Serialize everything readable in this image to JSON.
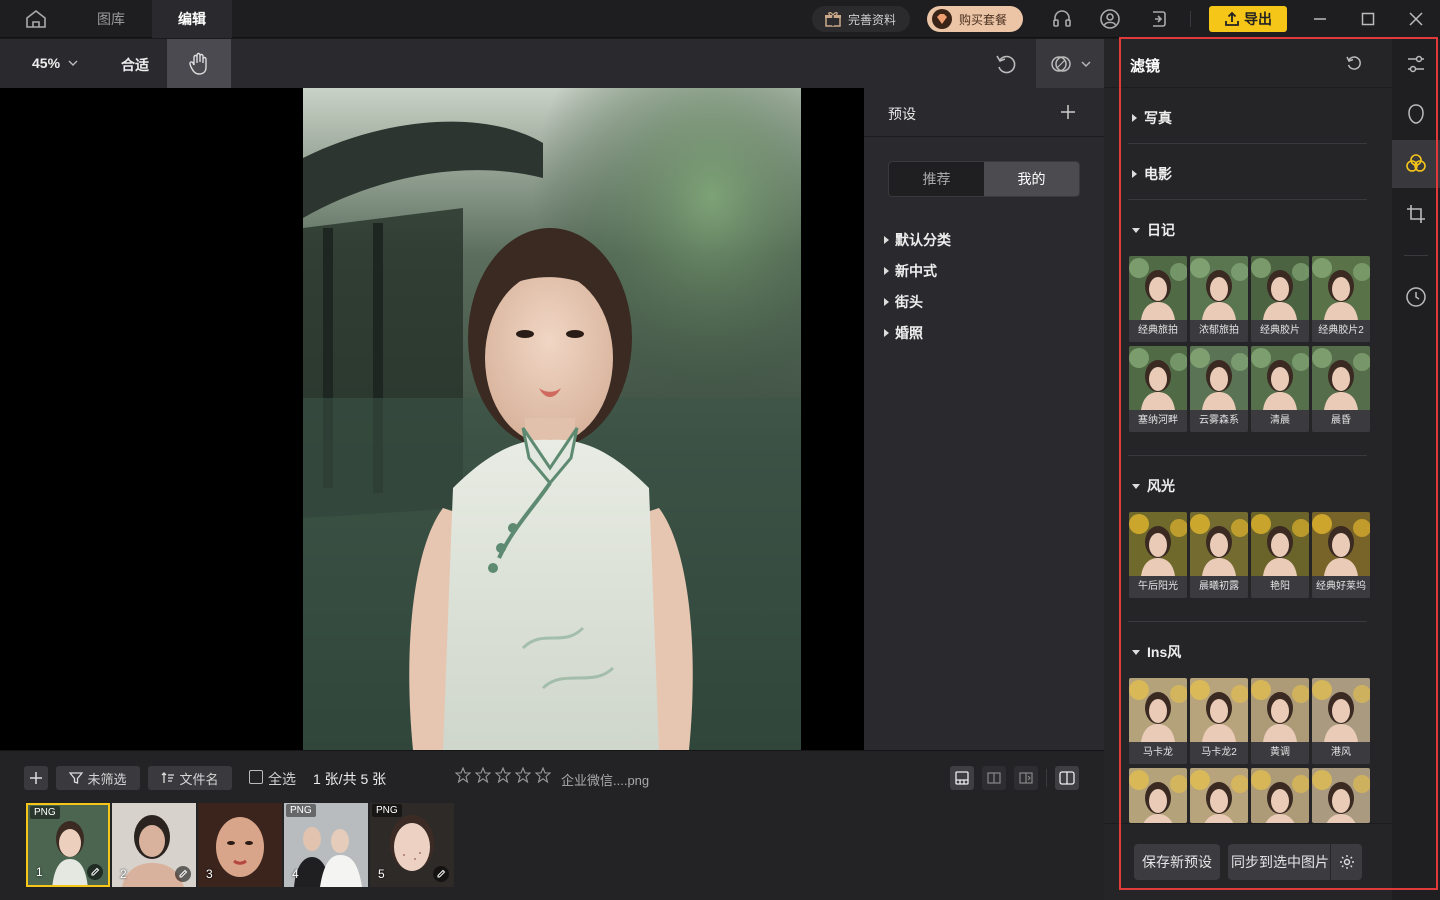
{
  "topbar": {
    "tabs": [
      {
        "label": "图库"
      },
      {
        "label": "编辑"
      }
    ],
    "profile_label": "完善资料",
    "buy_label": "购买套餐",
    "export_label": "导出"
  },
  "toolbar": {
    "zoom": "45%",
    "fit_label": "合适"
  },
  "presets": {
    "title": "预设",
    "seg": [
      "推荐",
      "我的"
    ],
    "active_seg": "我的",
    "categories": [
      "默认分类",
      "新中式",
      "街头",
      "婚照"
    ]
  },
  "filters": {
    "title": "滤镜",
    "sections": [
      {
        "label": "写真",
        "expanded": false
      },
      {
        "label": "电影",
        "expanded": false
      },
      {
        "label": "日记",
        "expanded": true,
        "items": [
          "经典旅拍",
          "浓郁旅拍",
          "经典胶片",
          "经典胶片2",
          "塞纳河畔",
          "云雾森系",
          "清晨",
          "晨昏"
        ]
      },
      {
        "label": "风光",
        "expanded": true,
        "items": [
          "午后阳光",
          "晨曦初露",
          "艳阳",
          "经典好莱坞"
        ]
      },
      {
        "label": "Ins风",
        "expanded": true,
        "items": [
          "马卡龙",
          "马卡龙2",
          "黄调",
          "港风"
        ]
      }
    ],
    "save_preset_label": "保存新预设",
    "sync_label": "同步到选中图片"
  },
  "bottom": {
    "filter_label": "未筛选",
    "sort_label": "文件名",
    "select_all_label": "全选",
    "count_text": "1 张/共 5 张",
    "filename": "企业微信....png",
    "rating": 0,
    "film": [
      {
        "num": "1",
        "tag": "PNG",
        "selected": true,
        "edited": true
      },
      {
        "num": "2",
        "tag": "",
        "selected": false,
        "edited": true
      },
      {
        "num": "3",
        "tag": "",
        "selected": false,
        "edited": false
      },
      {
        "num": "4",
        "tag": "PNG",
        "selected": false,
        "edited": false
      },
      {
        "num": "5",
        "tag": "PNG",
        "selected": false,
        "edited": true
      }
    ]
  },
  "colors": {
    "accent": "#f5c518",
    "highlight": "#e03a3a",
    "buy": "#ecc5a6"
  }
}
